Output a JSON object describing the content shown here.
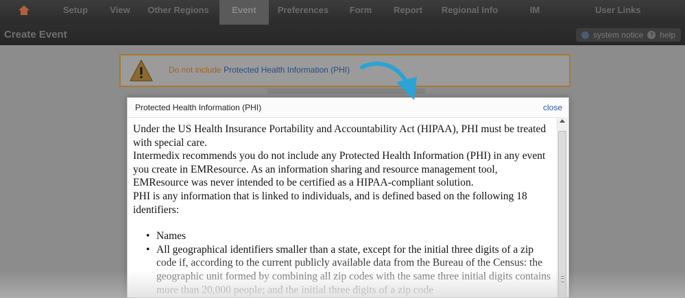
{
  "nav": {
    "home_icon": "home-icon",
    "items": [
      "Setup",
      "View",
      "Other Regions",
      "Event",
      "Preferences",
      "Form",
      "Report",
      "Regional Info",
      "IM",
      "User Links"
    ],
    "active": "Event"
  },
  "titlebar": {
    "title": "Create Event",
    "system_notice": "system notice",
    "help": "help",
    "help_glyph": "?"
  },
  "warning": {
    "prefix": "Do not include ",
    "link": "Protected Health Information (PHI)"
  },
  "modal": {
    "title": "Protected Health Information (PHI)",
    "close": "close",
    "paragraphs": [
      "Under the US Health Insurance Portability and Accountability Act (HIPAA), PHI must be treated with special care.",
      "Intermedix recommends you do not include any Protected Health Information (PHI) in any event you create in EMResource. As an information sharing and resource management tool, EMResource was never intended to be certified as a HIPAA-compliant solution.",
      "PHI is any information that is linked to individuals, and is defined based on the following 18 identifiers:"
    ],
    "list": [
      "Names",
      "All geographical identifiers smaller than a state, except for the initial three digits of a zip code if, according to the current publicly available data from the Bureau of the Census: the geographic unit formed by combining all zip codes with the same three initial digits contains more than 20,000 people; and the initial three digits of a zip code"
    ]
  },
  "colors": {
    "nav_bg": "#2b2b2b",
    "warning_border": "#a77a2f",
    "link": "#2d59a8",
    "arrow": "#2aa3d6"
  }
}
